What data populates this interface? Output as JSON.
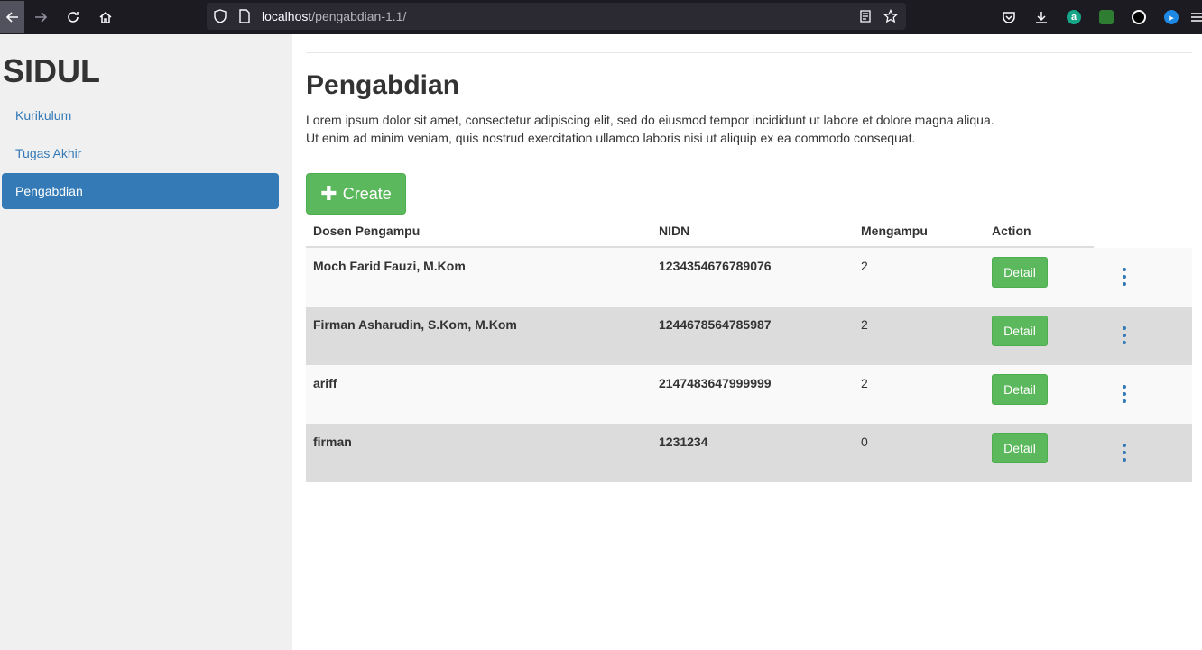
{
  "browser": {
    "url_host": "localhost",
    "url_path": "/pengabdian-1.1/"
  },
  "sidebar": {
    "brand": "SIDUL",
    "items": [
      {
        "label": "Kurikulum"
      },
      {
        "label": "Tugas Akhir"
      },
      {
        "label": "Pengabdian"
      }
    ]
  },
  "main": {
    "title": "Pengabdian",
    "lead_line1": "Lorem ipsum dolor sit amet, consectetur adipiscing elit, sed do eiusmod tempor incididunt ut labore et dolore magna aliqua.",
    "lead_line2": "Ut enim ad minim veniam, quis nostrud exercitation ullamco laboris nisi ut aliquip ex ea commodo consequat.",
    "create_label": "Create"
  },
  "table": {
    "headers": [
      "Dosen Pengampu",
      "NIDN",
      "Mengampu",
      "Action"
    ],
    "rows": [
      {
        "dosen": "Moch Farid Fauzi, M.Kom",
        "nidn": "1234354676789076",
        "mengampu": "2",
        "action": "Detail"
      },
      {
        "dosen": "Firman Asharudin, S.Kom, M.Kom",
        "nidn": "1244678564785987",
        "mengampu": "2",
        "action": "Detail"
      },
      {
        "dosen": "ariff",
        "nidn": "2147483647999999",
        "mengampu": "2",
        "action": "Detail"
      },
      {
        "dosen": "firman",
        "nidn": "1231234",
        "mengampu": "0",
        "action": "Detail"
      }
    ]
  }
}
